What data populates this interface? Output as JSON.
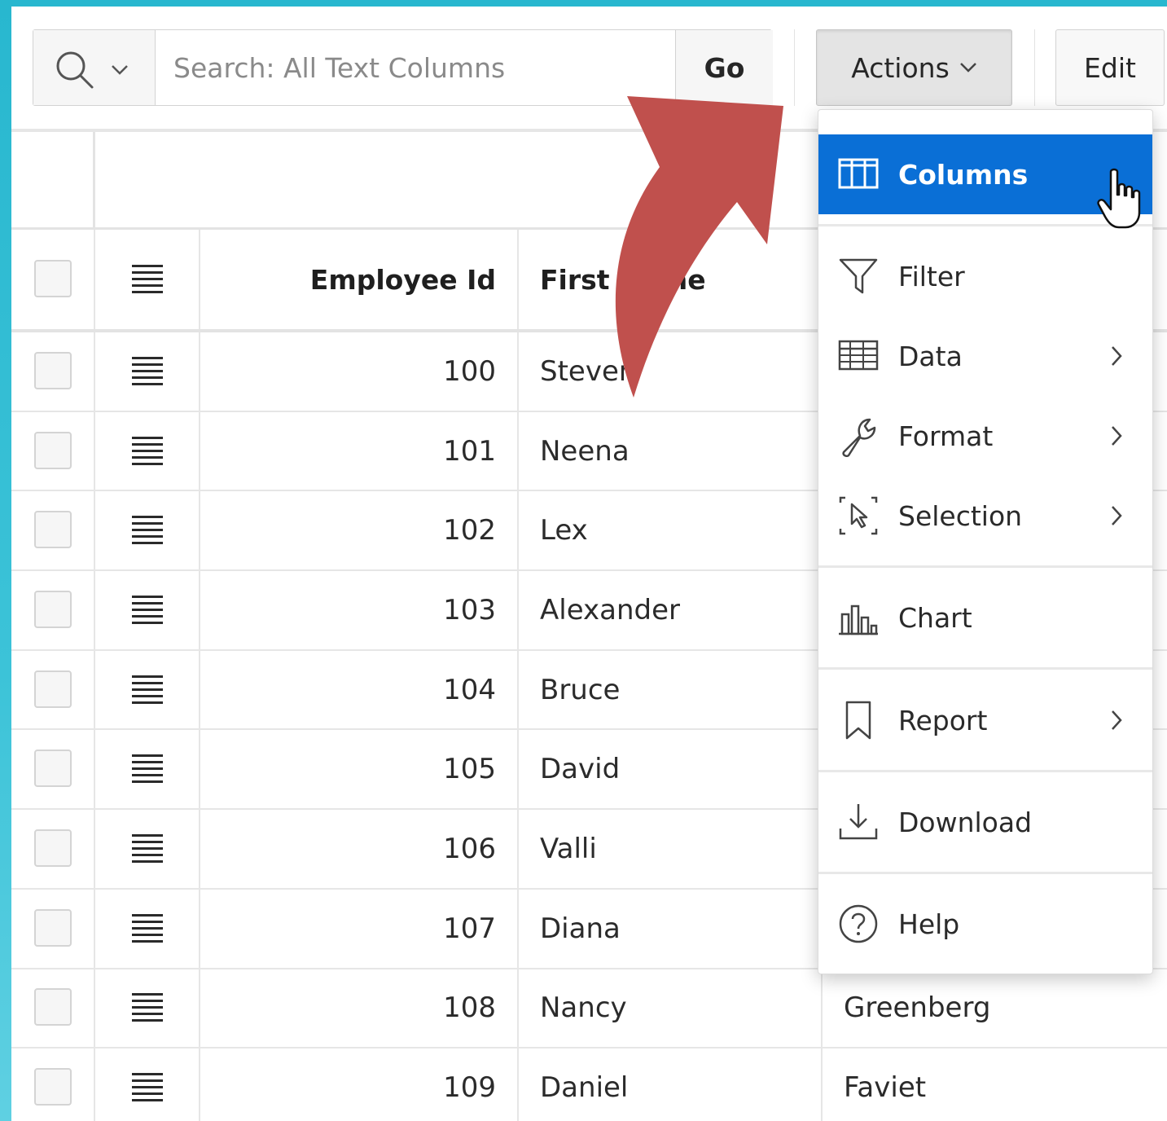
{
  "toolbar": {
    "search_placeholder": "Search: All Text Columns",
    "go_label": "Go",
    "actions_label": "Actions",
    "edit_label": "Edit"
  },
  "grid": {
    "headers": {
      "employee_id": "Employee Id",
      "first_name": "First Name"
    },
    "rows": [
      {
        "id": "100",
        "first": "Steven",
        "last": ""
      },
      {
        "id": "101",
        "first": "Neena",
        "last": ""
      },
      {
        "id": "102",
        "first": "Lex",
        "last": ""
      },
      {
        "id": "103",
        "first": "Alexander",
        "last": ""
      },
      {
        "id": "104",
        "first": "Bruce",
        "last": ""
      },
      {
        "id": "105",
        "first": "David",
        "last": ""
      },
      {
        "id": "106",
        "first": "Valli",
        "last": ""
      },
      {
        "id": "107",
        "first": "Diana",
        "last": ""
      },
      {
        "id": "108",
        "first": "Nancy",
        "last": "Greenberg"
      },
      {
        "id": "109",
        "first": "Daniel",
        "last": "Faviet"
      }
    ]
  },
  "actions_menu": {
    "items": [
      {
        "label": "Columns",
        "icon": "columns-icon",
        "submenu": false,
        "active": true
      },
      {
        "label": "Filter",
        "icon": "filter-icon",
        "submenu": false
      },
      {
        "label": "Data",
        "icon": "table-icon",
        "submenu": true
      },
      {
        "label": "Format",
        "icon": "wrench-icon",
        "submenu": true
      },
      {
        "label": "Selection",
        "icon": "selection-icon",
        "submenu": true
      },
      {
        "label": "Chart",
        "icon": "chart-icon",
        "submenu": false
      },
      {
        "label": "Report",
        "icon": "bookmark-icon",
        "submenu": true
      },
      {
        "label": "Download",
        "icon": "download-icon",
        "submenu": false
      },
      {
        "label": "Help",
        "icon": "help-icon",
        "submenu": false
      }
    ]
  },
  "colors": {
    "accent": "#0a6fd6",
    "annotation_arrow": "#c0504d",
    "frame_background": "#28b7cf"
  }
}
